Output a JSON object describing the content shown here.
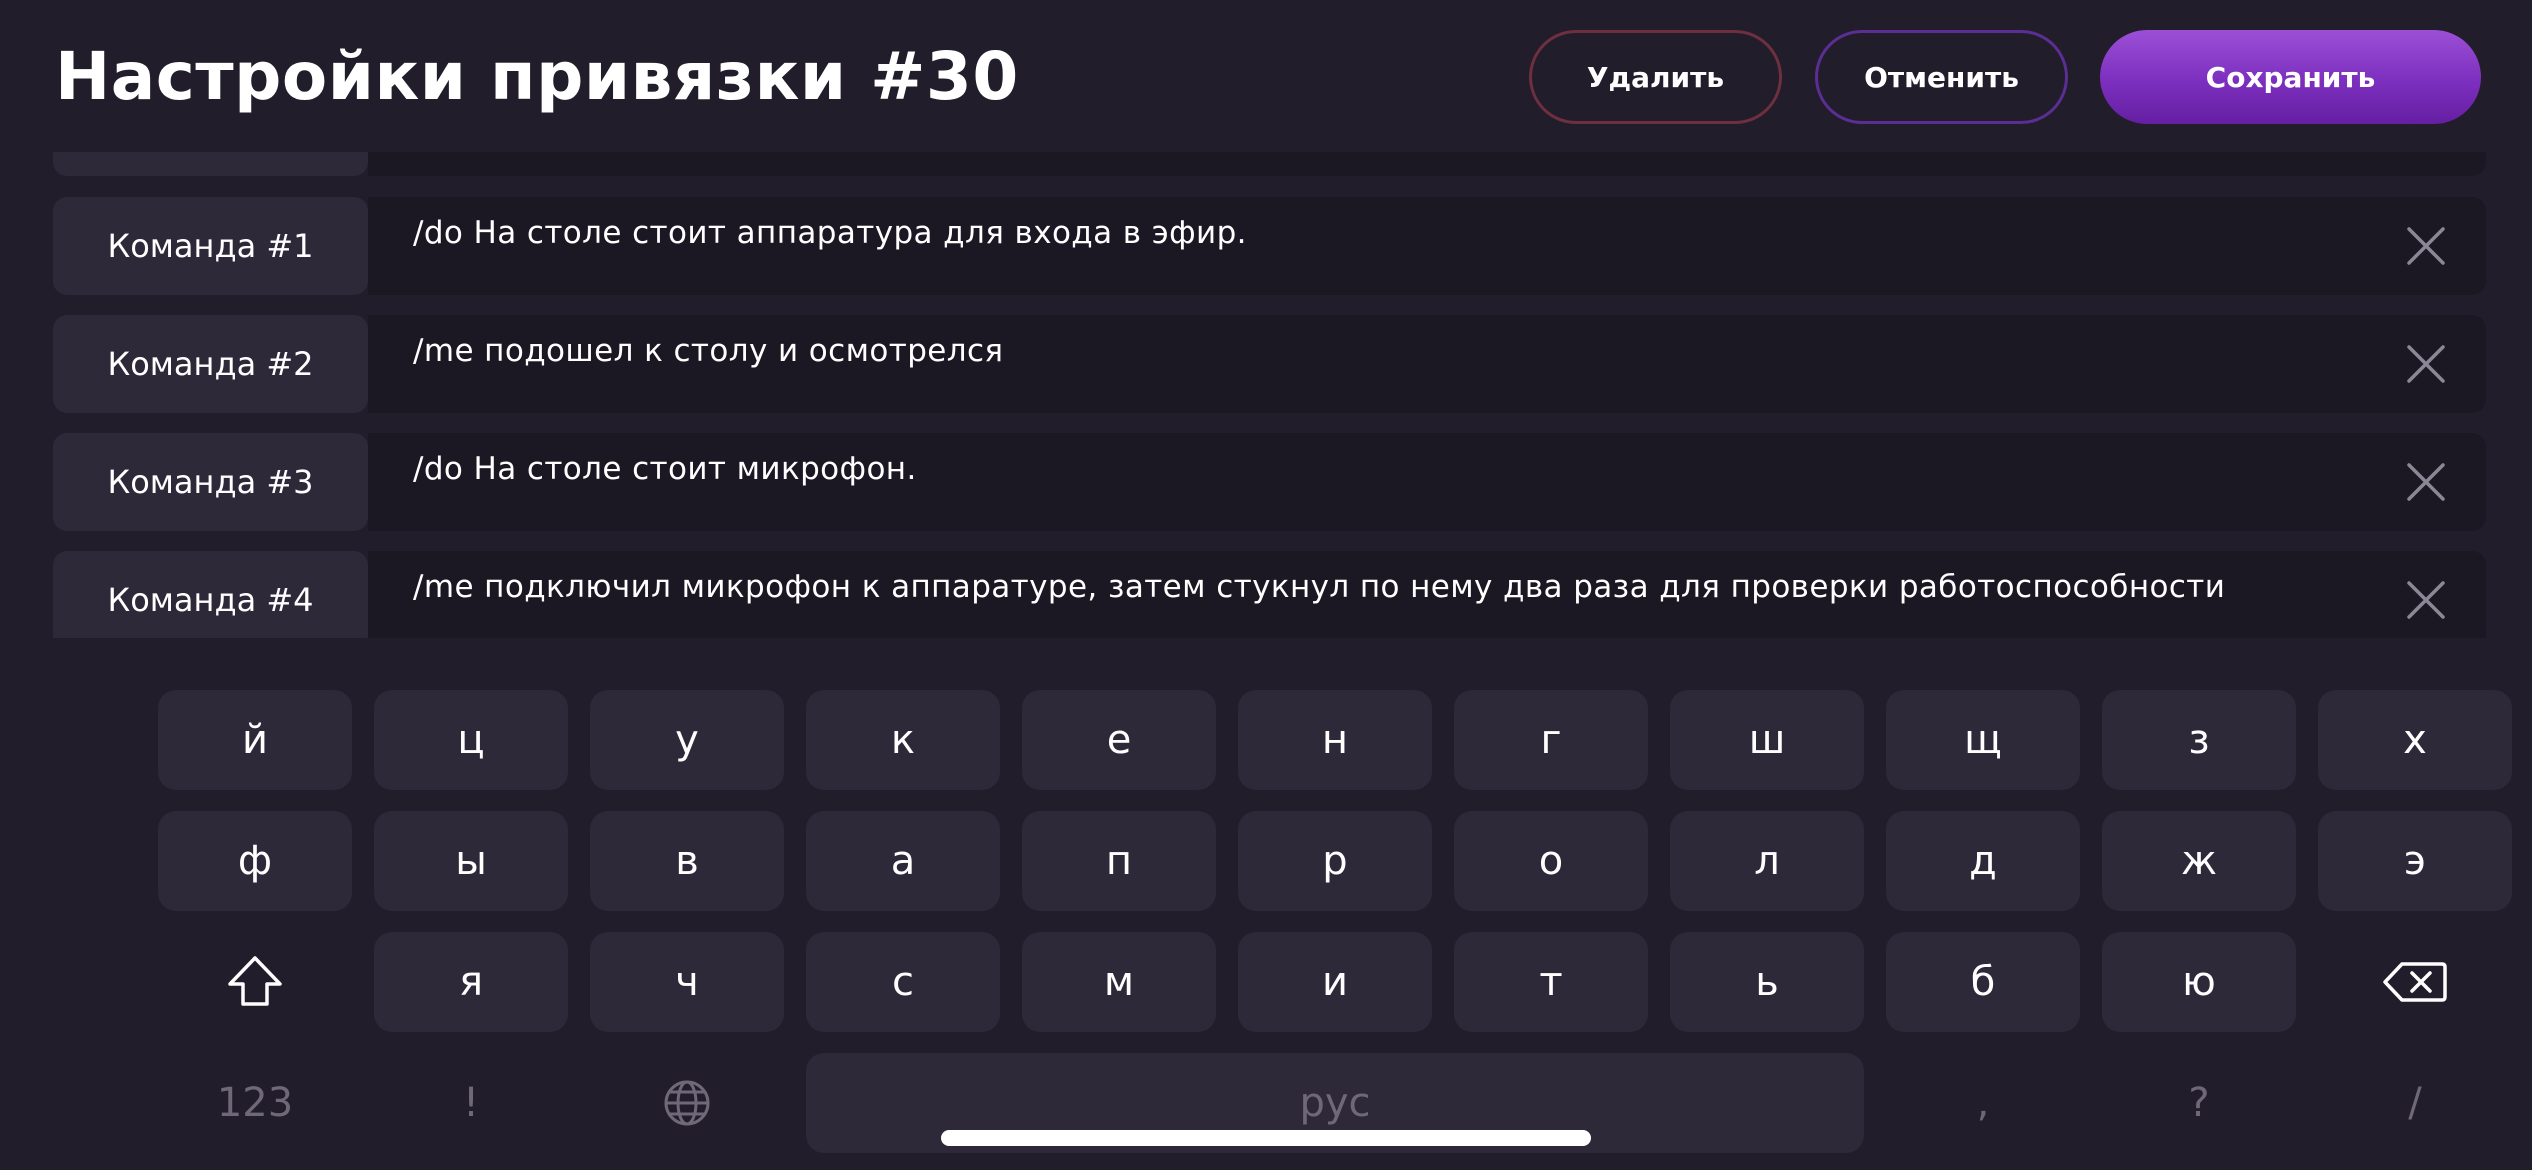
{
  "header": {
    "title": "Настройки привязки #30",
    "delete_label": "Удалить",
    "cancel_label": "Отменить",
    "save_label": "Сохранить"
  },
  "commands": [
    {
      "label": "Команда #1",
      "text": "/do На столе стоит аппаратура для входа в эфир."
    },
    {
      "label": "Команда #2",
      "text": "/me подошел к столу и осмотрелся"
    },
    {
      "label": "Команда #3",
      "text": "/do На столе стоит микрофон."
    },
    {
      "label": "Команда #4",
      "text": "/me подключил микрофон к аппаратуре, затем стукнул по нему два раза для проверки работоспособности"
    }
  ],
  "keyboard": {
    "row1": [
      "й",
      "ц",
      "у",
      "к",
      "е",
      "н",
      "г",
      "ш",
      "щ",
      "з",
      "х"
    ],
    "row2": [
      "ф",
      "ы",
      "в",
      "а",
      "п",
      "р",
      "о",
      "л",
      "д",
      "ж",
      "э"
    ],
    "row3": [
      "я",
      "ч",
      "с",
      "м",
      "и",
      "т",
      "ь",
      "б",
      "ю"
    ],
    "numbers_label": "123",
    "exclaim_label": "!",
    "space_label": "рус",
    "comma_label": ",",
    "question_label": "?",
    "slash_label": "/"
  },
  "colors": {
    "background": "#211d2b",
    "accent": "#7c2fbe",
    "delete_border": "#6e2f3f",
    "cancel_border": "#5a2e93"
  }
}
